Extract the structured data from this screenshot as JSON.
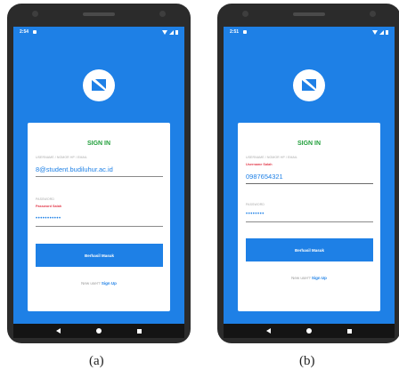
{
  "panels": [
    {
      "caption": "(a)",
      "status_time": "2:54",
      "title": "SIGN IN",
      "username_label": "USERNAME / NOMOR HP / EMAIL",
      "username_value": "8@student.budiluhur.ac.id",
      "username_error": "",
      "password_label": "PASSWORD",
      "password_error": "Password Salah",
      "password_value": "•••••••••••",
      "button_label": "Berhasil Masuk",
      "new_user_text": "New user?",
      "signup_link": "Sign Up"
    },
    {
      "caption": "(b)",
      "status_time": "2:51",
      "title": "SIGN IN",
      "username_label": "USERNAME / NOMOR HP / EMAIL",
      "username_value": "0987654321",
      "username_error": "Username Salah",
      "password_label": "PASSWORD",
      "password_error": "",
      "password_value": "••••••••",
      "button_label": "Berhasil Masuk",
      "new_user_text": "New user?",
      "signup_link": "Sign Up"
    }
  ],
  "colors": {
    "primary": "#1e80e6",
    "title_green": "#1f9e3a",
    "error_red": "#e23b4c",
    "phone_body": "#2b2b2b"
  },
  "icons": {
    "logo": "app-logo-icon",
    "nav": [
      "back-icon",
      "home-icon",
      "recents-icon"
    ]
  }
}
